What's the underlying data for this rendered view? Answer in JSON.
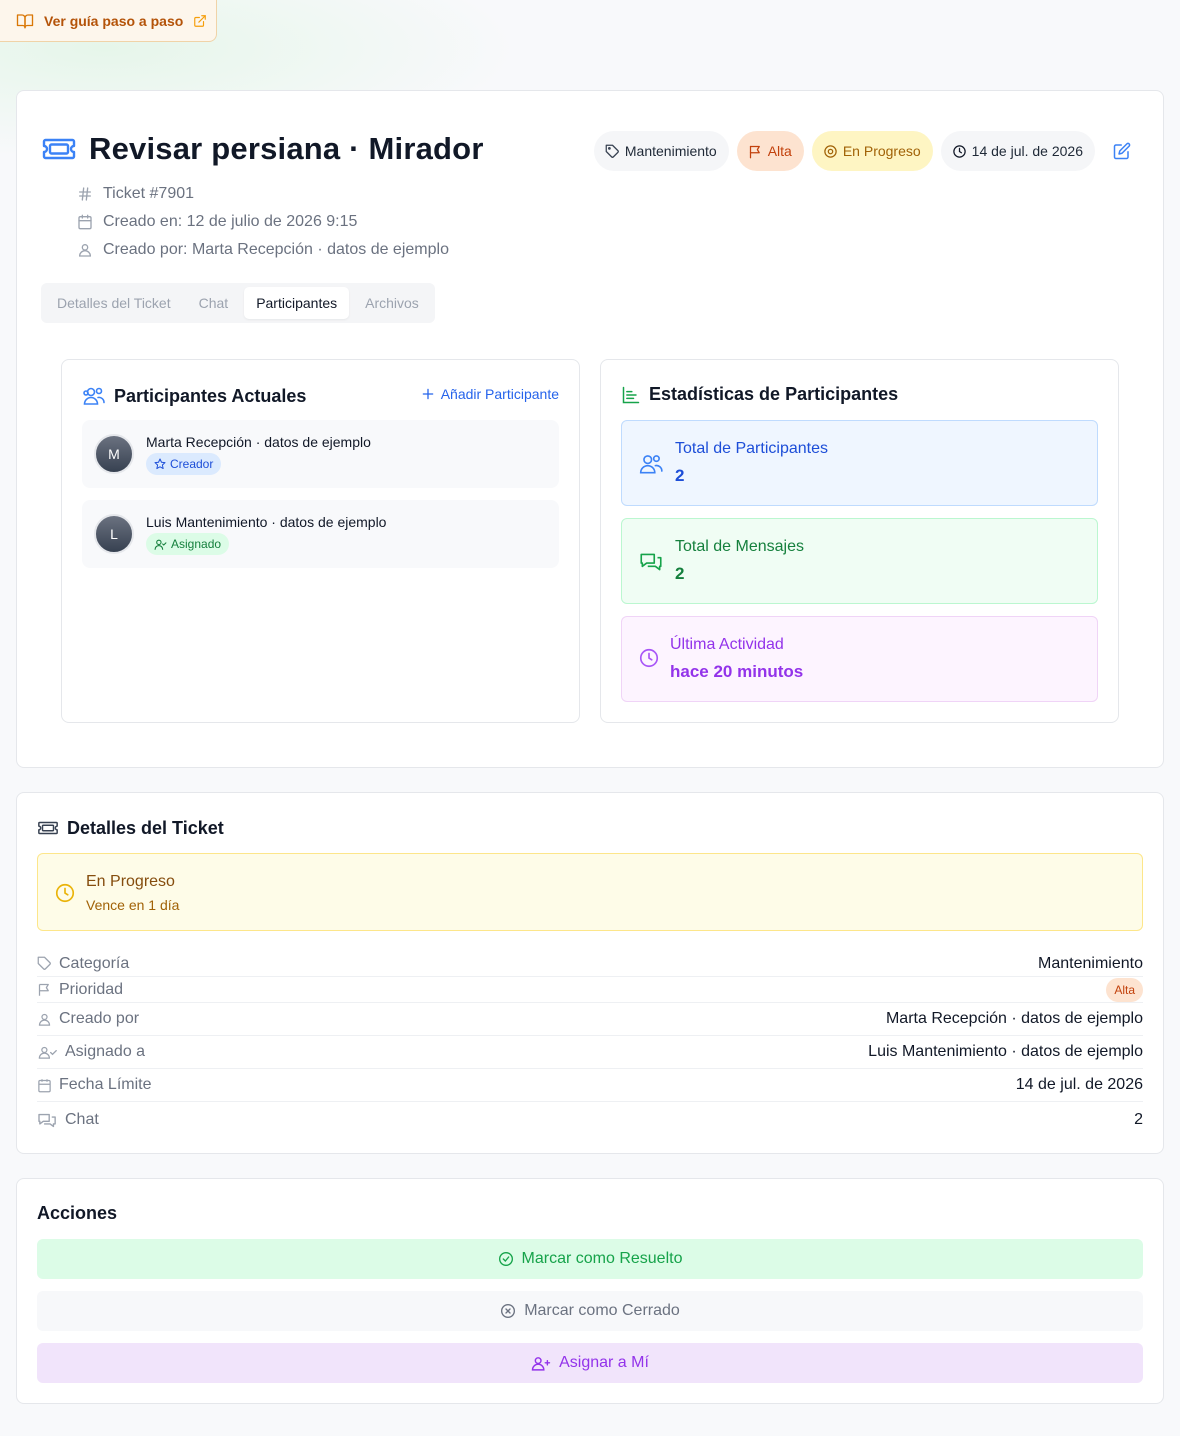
{
  "guide": {
    "label": "Ver guía paso a paso"
  },
  "ticket": {
    "title": "Revisar persiana · Mirador",
    "number": "Ticket #7901",
    "created_at": "Creado en: 12 de julio de 2026 9:15",
    "created_by": "Creado por: Marta Recepción · datos de ejemplo"
  },
  "badges": {
    "category": "Mantenimiento",
    "priority": "Alta",
    "status": "En Progreso",
    "due": "14 de jul. de 2026"
  },
  "tabs": [
    {
      "label": "Detalles del Ticket"
    },
    {
      "label": "Chat"
    },
    {
      "label": "Participantes"
    },
    {
      "label": "Archivos"
    }
  ],
  "participants": {
    "heading": "Participantes Actuales",
    "add_label": "Añadir Participante",
    "items": [
      {
        "initial": "M",
        "name": "Marta Recepción · datos de ejemplo",
        "role": "Creador"
      },
      {
        "initial": "L",
        "name": "Luis Mantenimiento · datos de ejemplo",
        "role": "Asignado"
      }
    ]
  },
  "stats": {
    "heading": "Estadísticas de Participantes",
    "total_participants": {
      "label": "Total de Participantes",
      "value": "2"
    },
    "total_messages": {
      "label": "Total de Mensajes",
      "value": "2"
    },
    "last_activity": {
      "label": "Última Actividad",
      "value": "hace 20 minutos"
    }
  },
  "details": {
    "heading": "Detalles del Ticket",
    "status_title": "En Progreso",
    "status_sub": "Vence en 1 día",
    "rows": {
      "category": {
        "label": "Categoría",
        "value": "Mantenimiento"
      },
      "priority": {
        "label": "Prioridad",
        "value": "Alta"
      },
      "created_by": {
        "label": "Creado por",
        "value": "Marta Recepción · datos de ejemplo"
      },
      "assigned_to": {
        "label": "Asignado a",
        "value": "Luis Mantenimiento · datos de ejemplo"
      },
      "due_date": {
        "label": "Fecha Límite",
        "value": "14 de jul. de 2026"
      },
      "chat": {
        "label": "Chat",
        "value": "2"
      }
    }
  },
  "actions": {
    "heading": "Acciones",
    "resolve": "Marcar como Resuelto",
    "close": "Marcar como Cerrado",
    "assign": "Asignar a Mí"
  },
  "colors": {
    "accent_blue": "#2563eb",
    "priority_high": "#c2410c",
    "status_progress": "#a16207",
    "success": "#16a34a",
    "purple": "#9333ea"
  }
}
